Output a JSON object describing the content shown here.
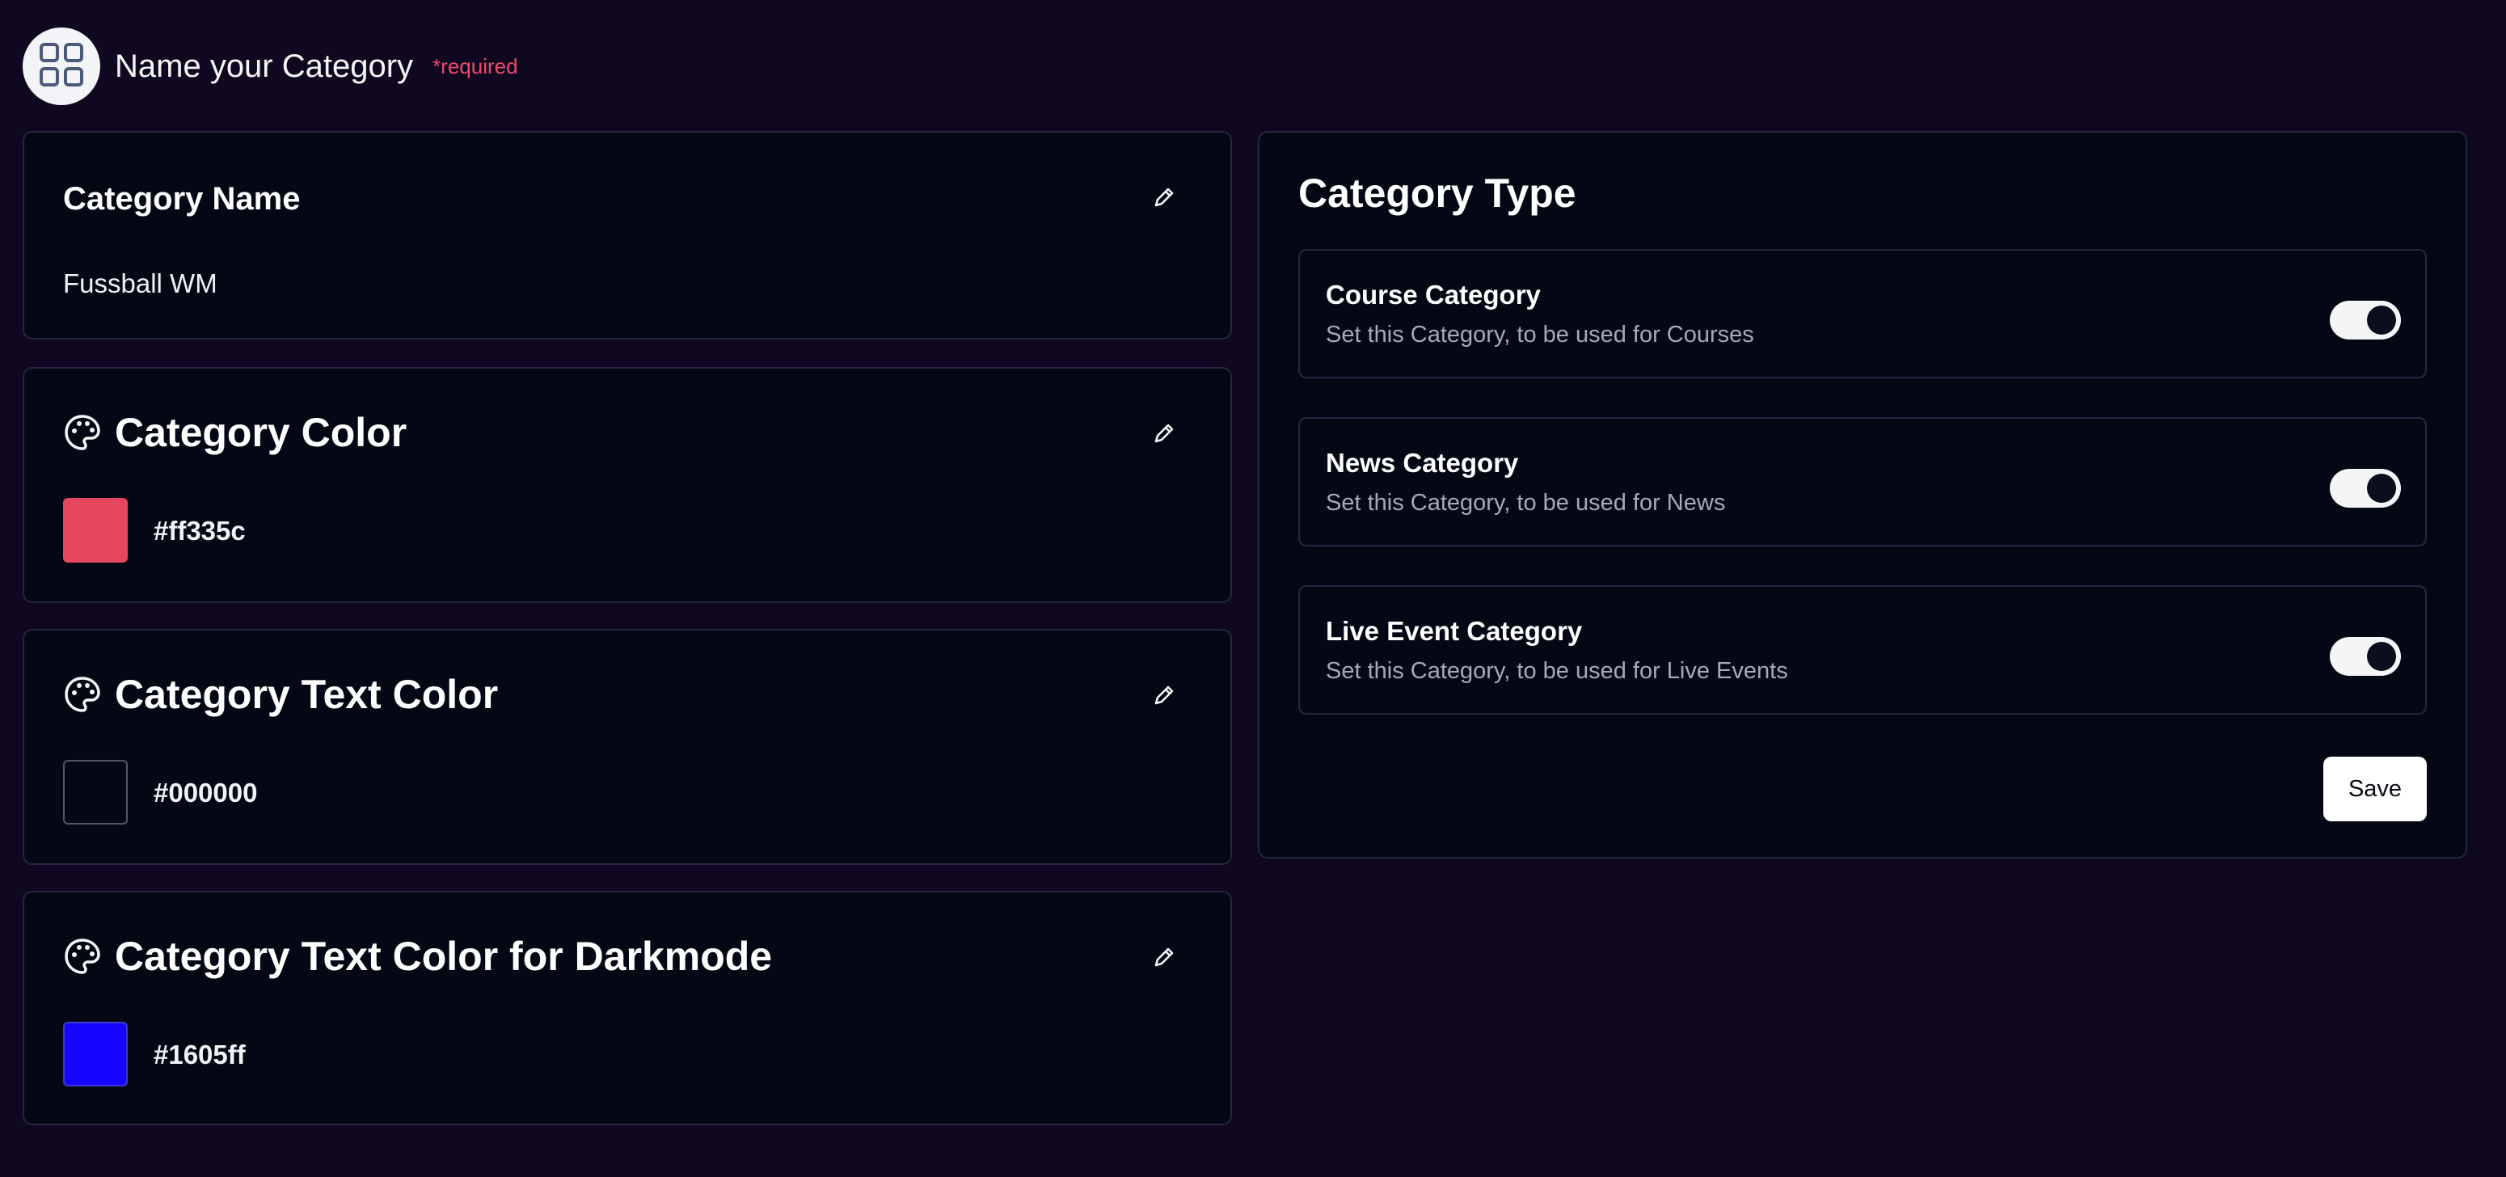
{
  "header": {
    "title": "Name your Category",
    "required_label": "*required",
    "icon": "grid-icon"
  },
  "cards": {
    "name": {
      "title": "Category Name",
      "value": "Fussball WM"
    },
    "color": {
      "title": "Category Color",
      "hex": "#ff335c",
      "swatch_color": "#e64760"
    },
    "text_color": {
      "title": "Category Text Color",
      "hex": "#000000",
      "swatch_color": "#040815"
    },
    "dark_text_color": {
      "title": "Category Text Color for Darkmode",
      "hex": "#1605ff",
      "swatch_color": "#1605ff"
    }
  },
  "category_type": {
    "title": "Category Type",
    "options": [
      {
        "title": "Course Category",
        "subtitle": "Set this Category, to be used for Courses",
        "enabled": true
      },
      {
        "title": "News Category",
        "subtitle": "Set this Category, to be used for News",
        "enabled": true
      },
      {
        "title": "Live Event Category",
        "subtitle": "Set this Category, to be used for Live Events",
        "enabled": true
      }
    ],
    "save_label": "Save"
  },
  "colors": {
    "background": "#0f0820",
    "card_background": "#040815",
    "border": "#262640",
    "required": "#ef4a6a"
  }
}
